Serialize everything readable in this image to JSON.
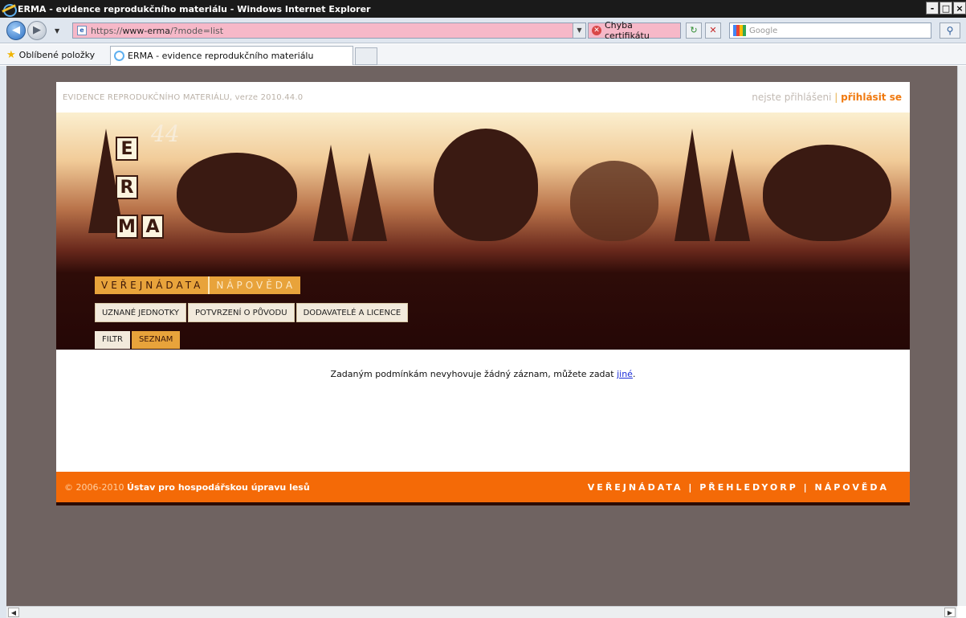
{
  "window": {
    "title": "ERMA - evidence reprodukčního materiálu - Windows Internet Explorer",
    "buttons": [
      "-",
      "□",
      "×"
    ]
  },
  "address_bar": {
    "url_prefix": "https://",
    "url_host": "www-erma",
    "url_path": "/?mode=list",
    "cert_error_label": "Chyba certifikátu",
    "search_placeholder": "Google"
  },
  "favorites_bar": {
    "favorites_label": "Oblíbené položky",
    "tab_label": "ERMA - evidence reprodukčního materiálu"
  },
  "site": {
    "version_text": "EVIDENCE REPRODUKČNÍHO MATERIÁLU, verze 2010.44.0",
    "login_status": "nejste přihlášeni",
    "login_separator": "|",
    "login_action": "přihlásit se",
    "logo_letters": [
      "E",
      "R",
      "M",
      "A"
    ],
    "logo_number": "44",
    "main_tabs": [
      "VEŘEJNÁDATA",
      "NÁPOVĚDA"
    ],
    "sub_tabs": [
      "UZNANÉ JEDNOTKY",
      "POTVRZENÍ O PŮVODU",
      "DODAVATELÉ A LICENCE"
    ],
    "view_tabs": [
      "FILTR",
      "SEZNAM"
    ],
    "message_prefix": "Zadaným podmínkám nevyhovuje žádný záznam, můžete zadat ",
    "message_link": "jiné",
    "message_suffix": ".",
    "footer_copyright": "© 2006-2010",
    "footer_org": "Ústav pro hospodářskou úpravu lesů",
    "footer_links": "VEŘEJNÁDATA | PŘEHLEDYORP | NÁPOVĚDA"
  },
  "colors": {
    "accent_orange": "#f46a07",
    "tab_gold": "#e8a33b",
    "banner_dark": "#2e0c08",
    "page_bg": "#6f6361"
  }
}
